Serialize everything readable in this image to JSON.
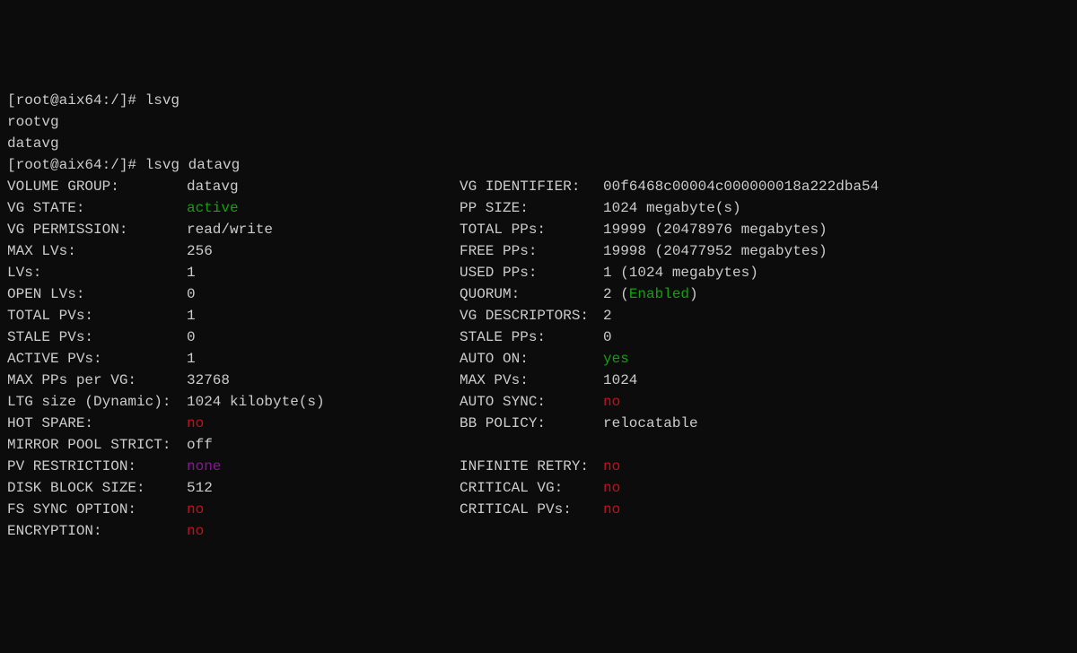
{
  "prompt1": {
    "prefix": "[root@aix64:/]# ",
    "command": "lsvg"
  },
  "output1": {
    "line1": "rootvg",
    "line2": "datavg"
  },
  "prompt2": {
    "prefix": "[root@aix64:/]# ",
    "command": "lsvg datavg"
  },
  "vg": {
    "left": {
      "volume_group": {
        "label": "VOLUME GROUP:",
        "value": "datavg"
      },
      "vg_state": {
        "label": "VG STATE:",
        "value": "active"
      },
      "vg_permission": {
        "label": "VG PERMISSION:",
        "value": "read/write"
      },
      "max_lvs": {
        "label": "MAX LVs:",
        "value": "256"
      },
      "lvs": {
        "label": "LVs:",
        "value": "1"
      },
      "open_lvs": {
        "label": "OPEN LVs:",
        "value": "0"
      },
      "total_pvs": {
        "label": "TOTAL PVs:",
        "value": "1"
      },
      "stale_pvs": {
        "label": "STALE PVs:",
        "value": "0"
      },
      "active_pvs": {
        "label": "ACTIVE PVs:",
        "value": "1"
      },
      "max_pps_per_vg": {
        "label": "MAX PPs per VG:",
        "value": "32768"
      },
      "ltg_size": {
        "label": "LTG size (Dynamic):",
        "value": "1024 kilobyte(s)"
      },
      "hot_spare": {
        "label": "HOT SPARE:",
        "value": "no"
      },
      "mirror_pool_strict": {
        "label": "MIRROR POOL STRICT:",
        "value": "off"
      },
      "pv_restriction": {
        "label": "PV RESTRICTION:",
        "value": "none"
      },
      "disk_block_size": {
        "label": "DISK BLOCK SIZE:",
        "value": "512"
      },
      "fs_sync_option": {
        "label": "FS SYNC OPTION:",
        "value": "no"
      },
      "encryption": {
        "label": "ENCRYPTION:",
        "value": "no"
      }
    },
    "right": {
      "vg_identifier": {
        "label": "VG IDENTIFIER:",
        "value": "00f6468c00004c000000018a222dba54"
      },
      "pp_size": {
        "label": "PP SIZE:",
        "value": "1024 megabyte(s)"
      },
      "total_pps": {
        "label": "TOTAL PPs:",
        "value": "19999 (20478976 megabytes)"
      },
      "free_pps": {
        "label": "FREE PPs:",
        "value": "19998 (20477952 megabytes)"
      },
      "used_pps": {
        "label": "USED PPs:",
        "value": "1 (1024 megabytes)"
      },
      "quorum": {
        "label": "QUORUM:",
        "value_prefix": "2 (",
        "value_highlight": "Enabled",
        "value_suffix": ")"
      },
      "vg_descriptors": {
        "label": "VG DESCRIPTORS:",
        "value": "2"
      },
      "stale_pps": {
        "label": "STALE PPs:",
        "value": "0"
      },
      "auto_on": {
        "label": "AUTO ON:",
        "value": "yes"
      },
      "max_pvs": {
        "label": "MAX PVs:",
        "value": "1024"
      },
      "auto_sync": {
        "label": "AUTO SYNC:",
        "value": "no"
      },
      "bb_policy": {
        "label": "BB POLICY:",
        "value": "relocatable"
      },
      "infinite_retry": {
        "label": "INFINITE RETRY:",
        "value": "no"
      },
      "critical_vg": {
        "label": "CRITICAL VG:",
        "value": "no"
      },
      "critical_pvs": {
        "label": "CRITICAL PVs:",
        "value": "no"
      }
    }
  }
}
